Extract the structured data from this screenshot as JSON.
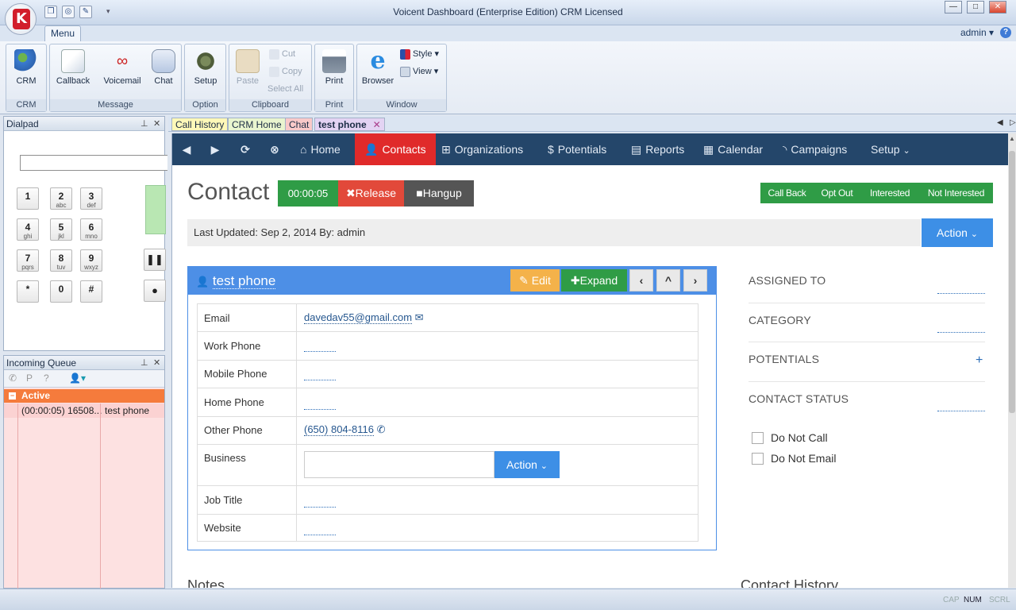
{
  "window": {
    "title": "Voicent Dashboard (Enterprise Edition) CRM Licensed"
  },
  "ribbon": {
    "menu_tab": "Menu",
    "user": "admin",
    "groups": [
      {
        "label": "CRM",
        "buttons": [
          "CRM"
        ]
      },
      {
        "label": "Message",
        "buttons": [
          "Callback",
          "Voicemail",
          "Chat"
        ]
      },
      {
        "label": "Option",
        "buttons": [
          "Setup"
        ]
      },
      {
        "label": "Clipboard",
        "buttons": [
          "Paste",
          "Cut",
          "Copy",
          "Select All"
        ]
      },
      {
        "label": "Print",
        "buttons": [
          "Print"
        ]
      },
      {
        "label": "Window",
        "buttons": [
          "Browser",
          "Style",
          "View"
        ]
      }
    ]
  },
  "dialpad": {
    "title": "Dialpad",
    "keys": [
      {
        "digit": "1",
        "letters": ""
      },
      {
        "digit": "2",
        "letters": "abc"
      },
      {
        "digit": "3",
        "letters": "def"
      },
      {
        "digit": "4",
        "letters": "ghi"
      },
      {
        "digit": "5",
        "letters": "jkl"
      },
      {
        "digit": "6",
        "letters": "mno"
      },
      {
        "digit": "7",
        "letters": "pqrs"
      },
      {
        "digit": "8",
        "letters": "tuv"
      },
      {
        "digit": "9",
        "letters": "wxyz"
      },
      {
        "digit": "*",
        "letters": ""
      },
      {
        "digit": "0",
        "letters": ""
      },
      {
        "digit": "#",
        "letters": ""
      }
    ]
  },
  "queue": {
    "title": "Incoming Queue",
    "group": "Active",
    "rows": [
      {
        "time": "(00:00:05) 16508...",
        "name": "test phone"
      }
    ]
  },
  "doc_tabs": [
    "Call History",
    "CRM Home",
    "Chat",
    "test phone"
  ],
  "nav": {
    "items": [
      "Home",
      "Contacts",
      "Organizations",
      "Potentials",
      "Reports",
      "Calendar",
      "Campaigns",
      "Setup"
    ]
  },
  "contact": {
    "page_title": "Contact",
    "timer": "00:00:05",
    "release": "Release",
    "hangup": "Hangup",
    "status_buttons": [
      "Call Back",
      "Opt Out",
      "Interested",
      "Not Interested"
    ],
    "last_updated": "Last Updated: Sep 2, 2014 By: admin",
    "action": "Action",
    "name": "test phone",
    "edit": "Edit",
    "expand": "Expand",
    "fields": {
      "email_label": "Email",
      "email_value": "davedav55@gmail.com",
      "work_label": "Work Phone",
      "mobile_label": "Mobile Phone",
      "home_label": "Home Phone",
      "other_label": "Other Phone",
      "other_value": "(650) 804-8116",
      "business_label": "Business",
      "business_action": "Action",
      "job_label": "Job Title",
      "website_label": "Website"
    },
    "side": {
      "assigned_to": "ASSIGNED TO",
      "category": "CATEGORY",
      "potentials": "POTENTIALS",
      "contact_status": "CONTACT STATUS",
      "do_not_call": "Do Not Call",
      "do_not_email": "Do Not Email"
    },
    "bottom": {
      "notes": "Notes",
      "history": "Contact History"
    }
  },
  "status": {
    "cap": "CAP",
    "num": "NUM",
    "scrl": "SCRL"
  },
  "colors": {
    "nav": "#24466a",
    "active_nav": "#e02a2a",
    "card": "#4d8fe6",
    "green": "#2f9c46",
    "queue_active": "#f57b3c"
  }
}
